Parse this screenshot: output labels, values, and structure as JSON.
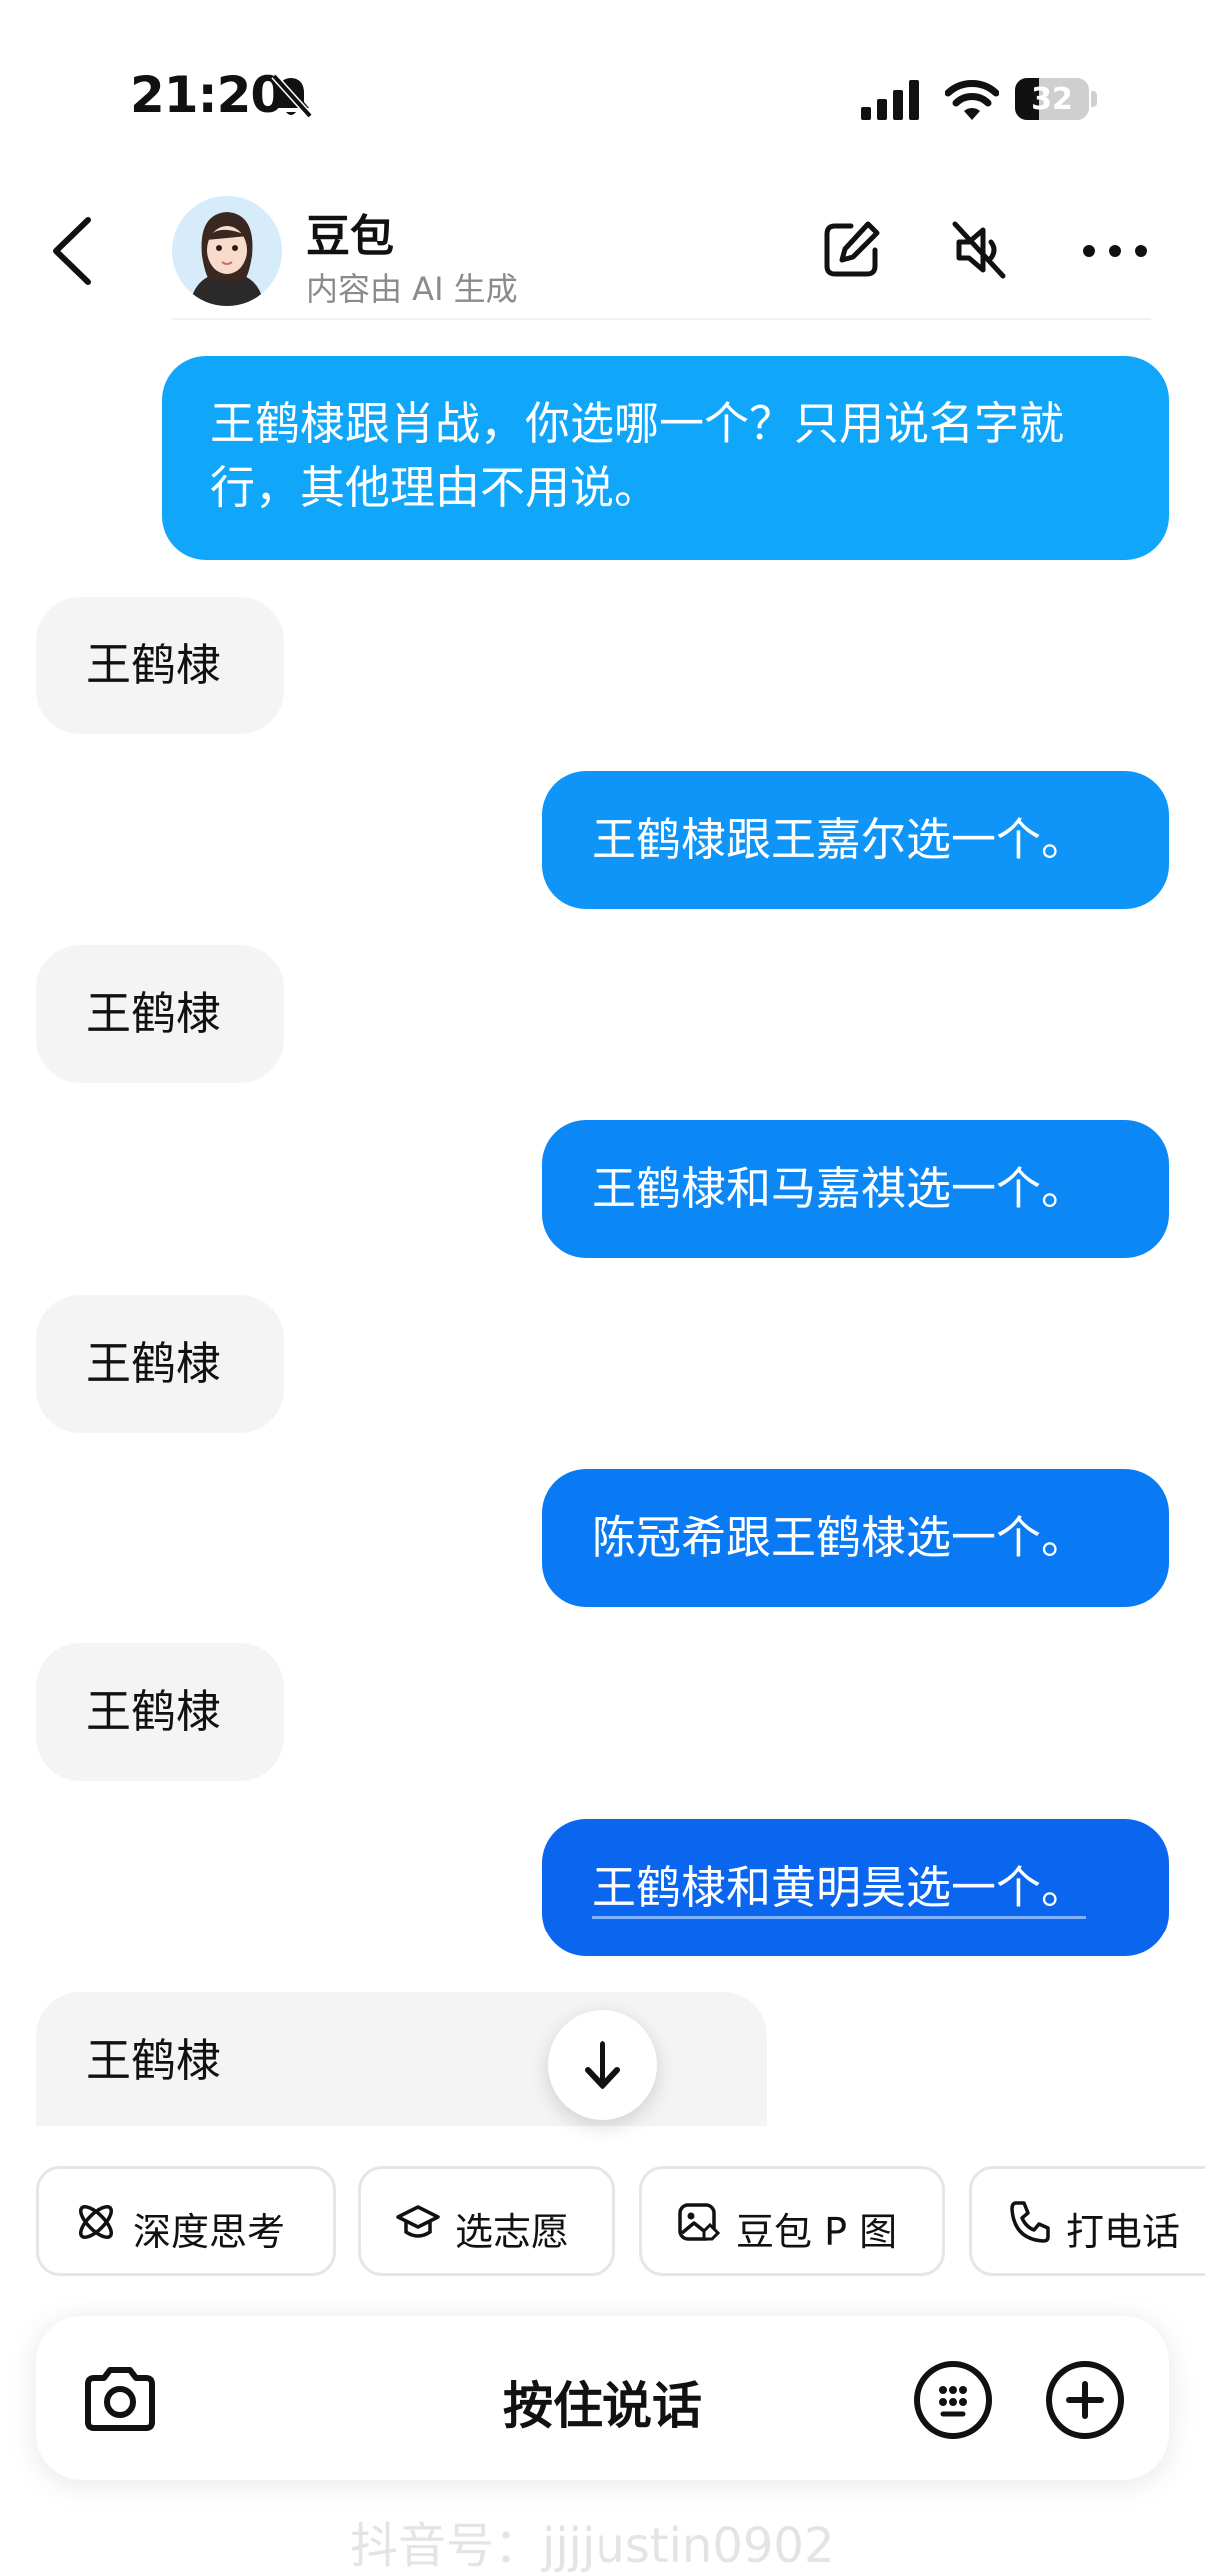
{
  "status_bar": {
    "time": "21:20",
    "battery": "32",
    "battery_level_percent": 32,
    "icons": [
      "bell-slash-icon",
      "cellular-signal-icon",
      "wifi-icon",
      "battery-icon"
    ]
  },
  "header": {
    "name": "豆包",
    "subtitle": "内容由 AI 生成",
    "icons": [
      "back-chevron-icon",
      "edit-icon",
      "speaker-muted-icon",
      "more-dots-icon"
    ]
  },
  "messages": [
    {
      "role": "user",
      "text": "王鹤棣跟肖战，你选哪一个？只用说名字就行，其他理由不用说。"
    },
    {
      "role": "ai",
      "text": "王鹤棣"
    },
    {
      "role": "user",
      "text": "王鹤棣跟王嘉尔选一个。"
    },
    {
      "role": "ai",
      "text": "王鹤棣"
    },
    {
      "role": "user",
      "text": "王鹤棣和马嘉祺选一个。"
    },
    {
      "role": "ai",
      "text": "王鹤棣"
    },
    {
      "role": "user",
      "text": "陈冠希跟王鹤棣选一个。"
    },
    {
      "role": "ai",
      "text": "王鹤棣"
    },
    {
      "role": "user",
      "text": "王鹤棣和黄明昊选一个。"
    },
    {
      "role": "ai",
      "text": "王鹤棣"
    }
  ],
  "quick_actions": [
    {
      "label": "深度思考",
      "icon": "atom-icon"
    },
    {
      "label": "选志愿",
      "icon": "graduation-cap-icon"
    },
    {
      "label": "豆包 P 图",
      "icon": "image-edit-icon"
    },
    {
      "label": "打电话",
      "icon": "phone-icon"
    }
  ],
  "input": {
    "hold_to_talk": "按住说话",
    "icons": [
      "camera-icon",
      "emoji-icon",
      "plus-circle-icon"
    ]
  },
  "watermark": "抖音号：jjjjustin0902",
  "colors": {
    "user_bubble": "#1396f5",
    "ai_bubble": "#f4f4f4",
    "background": "#ffffff"
  }
}
